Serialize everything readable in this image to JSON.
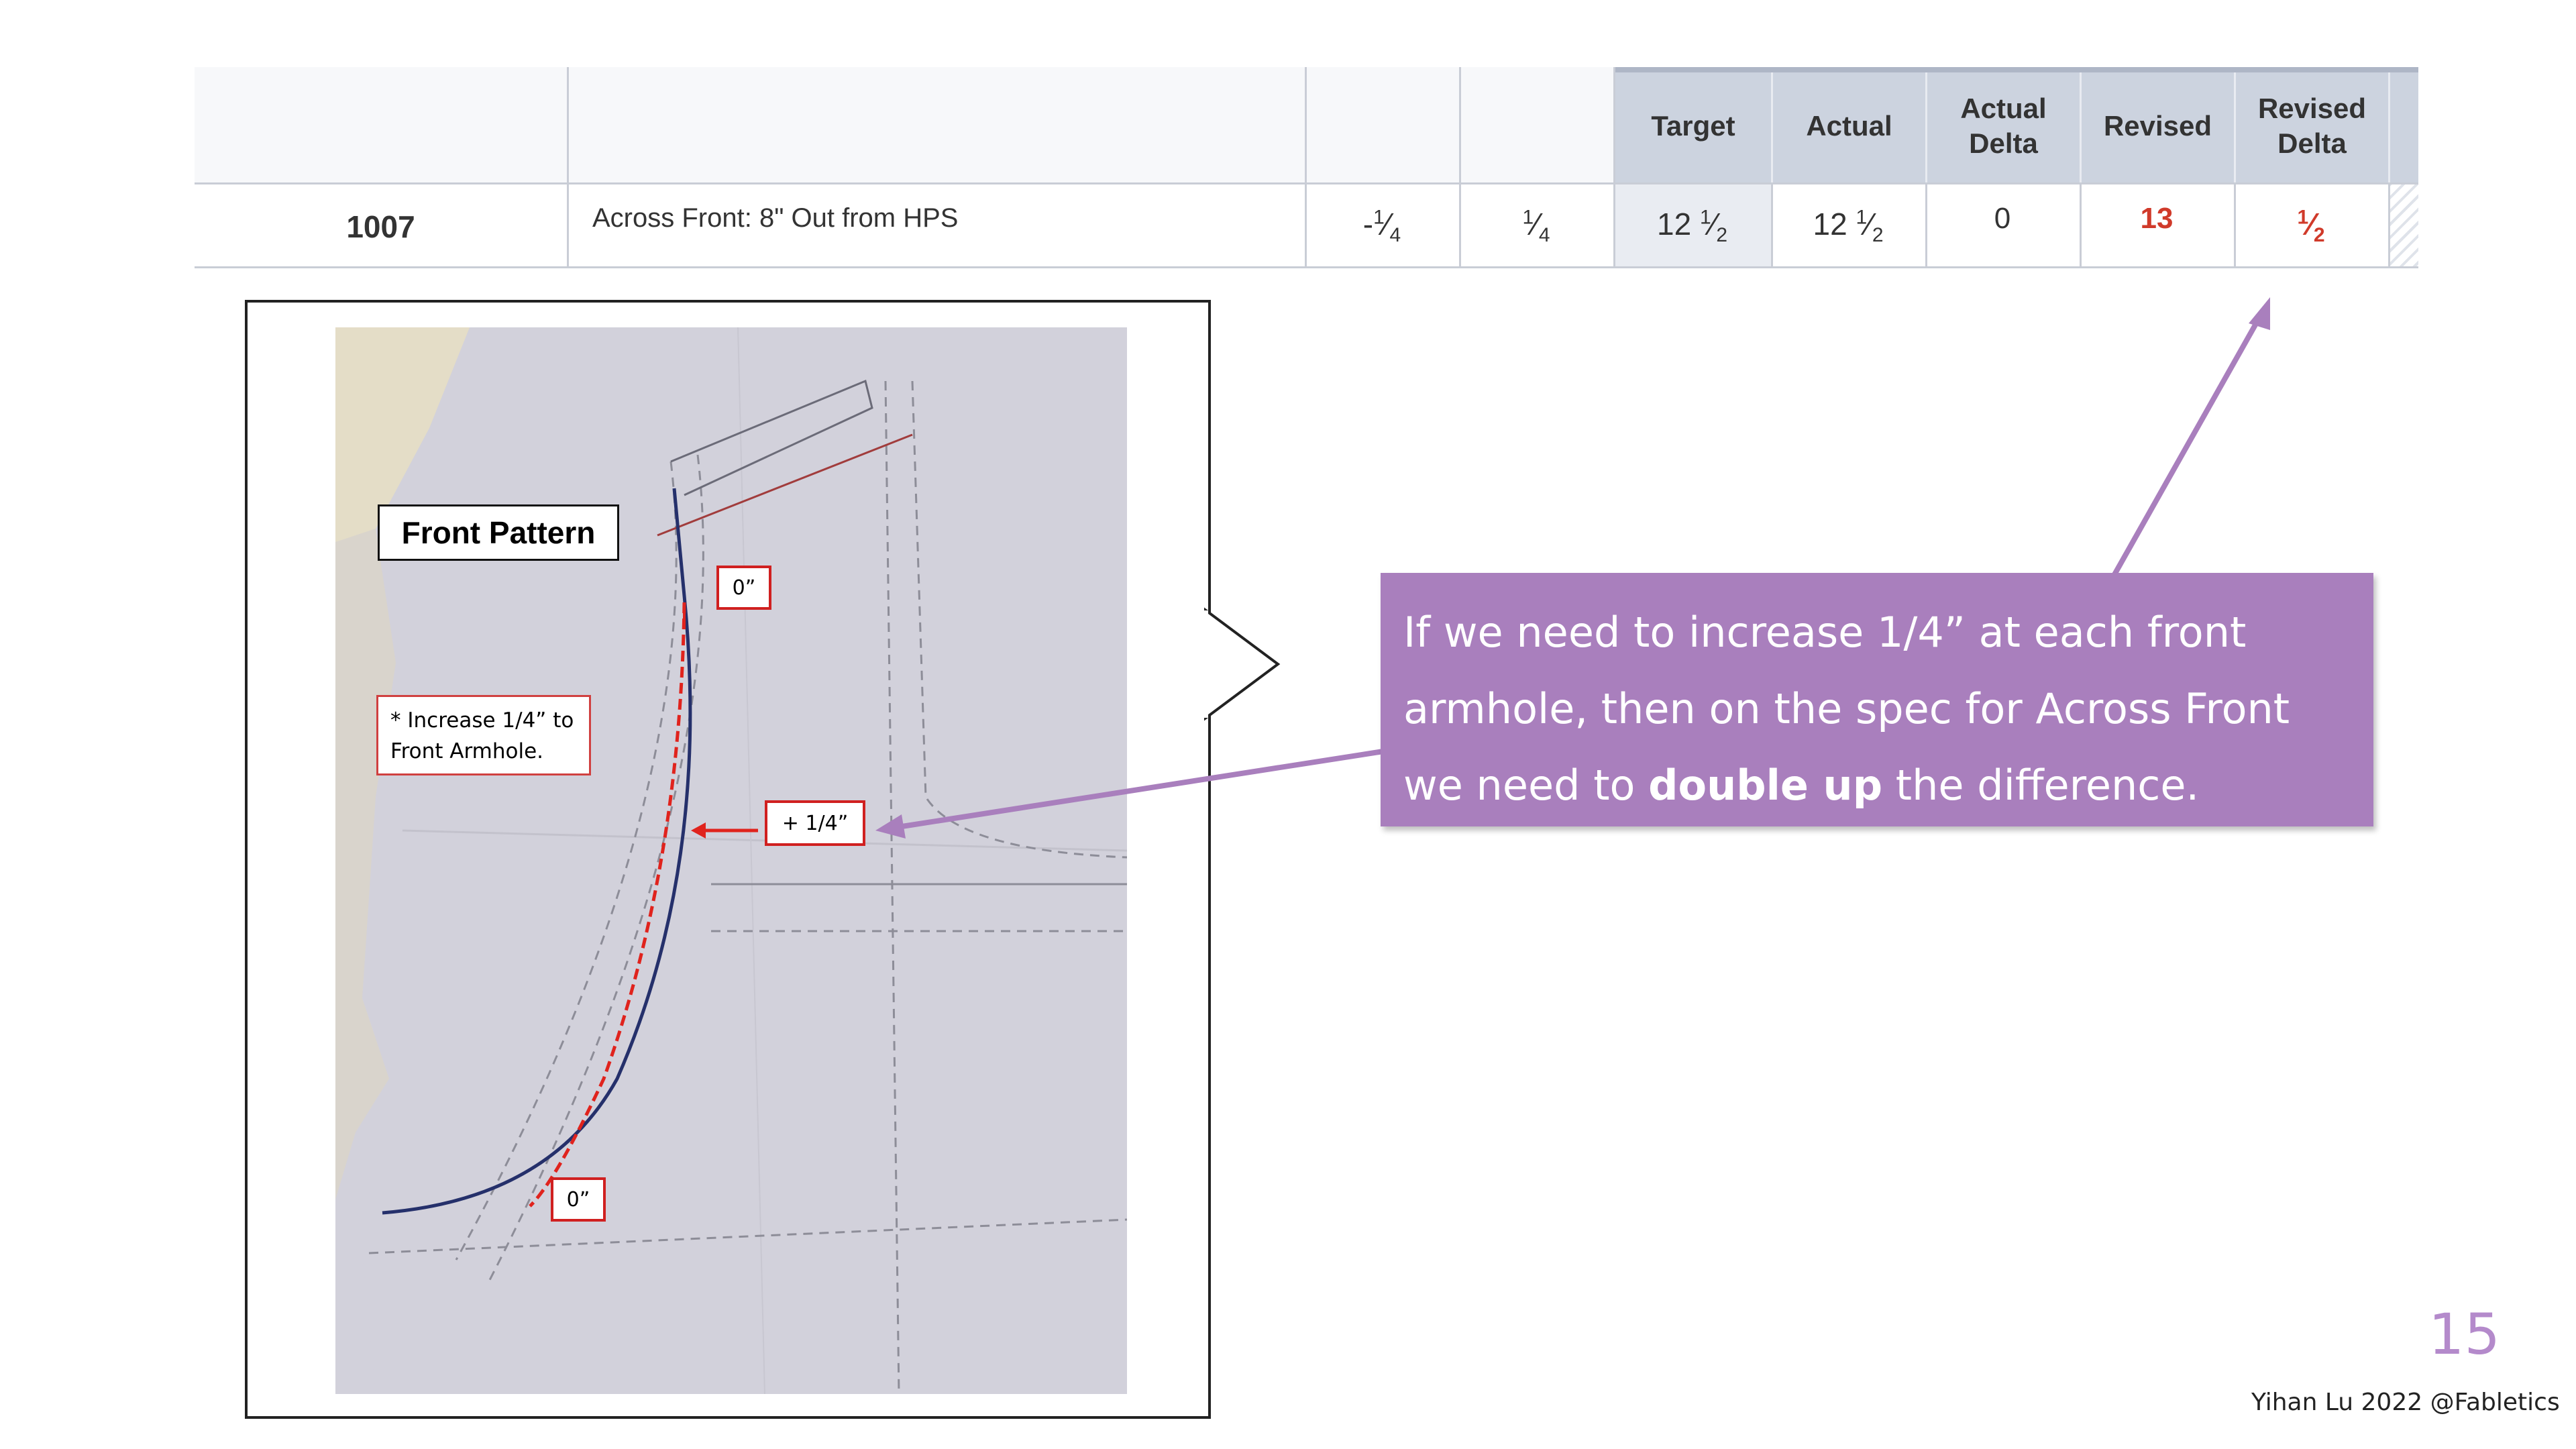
{
  "table": {
    "headers": [
      "Target",
      "Actual",
      "Actual\nDelta",
      "Revised",
      "Revised\nDelta"
    ],
    "row": {
      "code": "1007",
      "description": "Across Front: 8\" Out from HPS",
      "tol_minus": {
        "sign": "-",
        "num": "1",
        "den": "4"
      },
      "tol_plus": {
        "num": "1",
        "den": "4"
      },
      "target": {
        "whole": "12",
        "num": "1",
        "den": "2"
      },
      "actual": {
        "whole": "12",
        "num": "1",
        "den": "2"
      },
      "actual_delta": "0",
      "revised": "13",
      "revised_delta": {
        "num": "1",
        "den": "2"
      }
    }
  },
  "photo": {
    "title": "Front Pattern",
    "note_line1": "* Increase 1/4” to",
    "note_line2": "Front Armhole.",
    "marker_top": "0”",
    "marker_mid": "+ 1/4”",
    "marker_bottom": "0”"
  },
  "callout": {
    "line1": "If we need to increase 1/4” at each front",
    "line2": "armhole, then on the spec for Across Front",
    "line3_pre": "we need to ",
    "line3_bold": "double up",
    "line3_post": " the difference."
  },
  "page_number": "15",
  "footer": "Yihan Lu 2022 @Fabletics",
  "colors": {
    "header_bg": "#ccd3df",
    "accent_red": "#d03a2a",
    "callout_bg": "#a97fbd",
    "arrow": "#a97fbd",
    "page_number": "#b48acb"
  }
}
